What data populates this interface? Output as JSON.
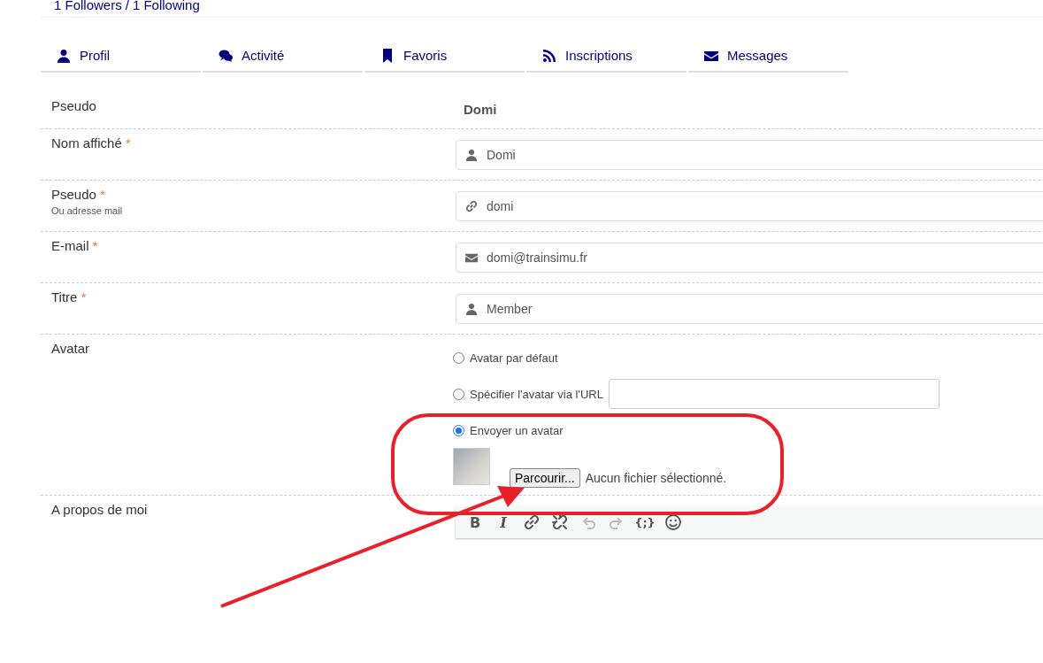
{
  "follow_line": {
    "followers": "1 Followers",
    "separator": "/",
    "following": "1 Following"
  },
  "tabs": [
    {
      "label": "Profil",
      "selected": false
    },
    {
      "label": "Activité",
      "selected": false
    },
    {
      "label": "Favoris",
      "selected": false
    },
    {
      "label": "Inscriptions",
      "selected": false
    },
    {
      "label": "Messages",
      "selected": false
    }
  ],
  "form": [
    {
      "kind": "static",
      "label": "Pseudo",
      "value": "Domi"
    },
    {
      "kind": "input",
      "label": "Nom affiché",
      "required": "*",
      "value": "Domi"
    },
    {
      "kind": "input",
      "label": "Pseudo",
      "required": "*",
      "hint": "Ou adresse mail",
      "value": "domi"
    },
    {
      "kind": "input",
      "label": "E-mail",
      "required": "*",
      "value": "domi@trainsimu.fr"
    },
    {
      "kind": "input",
      "label": "Titre",
      "required": "*",
      "value": "Member"
    },
    {
      "kind": "avatar",
      "label": "Avatar",
      "options": [
        {
          "kind": "plain",
          "label": "Avatar par défaut",
          "selected": false
        },
        {
          "kind": "url",
          "label": "Spécifier l'avatar via l'URL",
          "selected": false
        },
        {
          "kind": "upload",
          "label": "Envoyer un avatar",
          "selected": true
        }
      ],
      "browse_button": "Parcourir...",
      "file_status": "Aucun fichier sélectionné."
    },
    {
      "kind": "editor",
      "label": "A propos de moi",
      "toolbar": [
        {
          "kind": "bold",
          "glyph": "B",
          "disabled": false
        },
        {
          "kind": "italic",
          "glyph": "I",
          "disabled": false
        },
        {
          "kind": "link",
          "disabled": false
        },
        {
          "kind": "unlink",
          "disabled": false
        },
        {
          "kind": "undo",
          "disabled": true
        },
        {
          "kind": "redo",
          "disabled": true
        },
        {
          "kind": "code",
          "glyph": "{;}",
          "disabled": false
        },
        {
          "kind": "emoji",
          "disabled": false
        }
      ]
    }
  ]
}
